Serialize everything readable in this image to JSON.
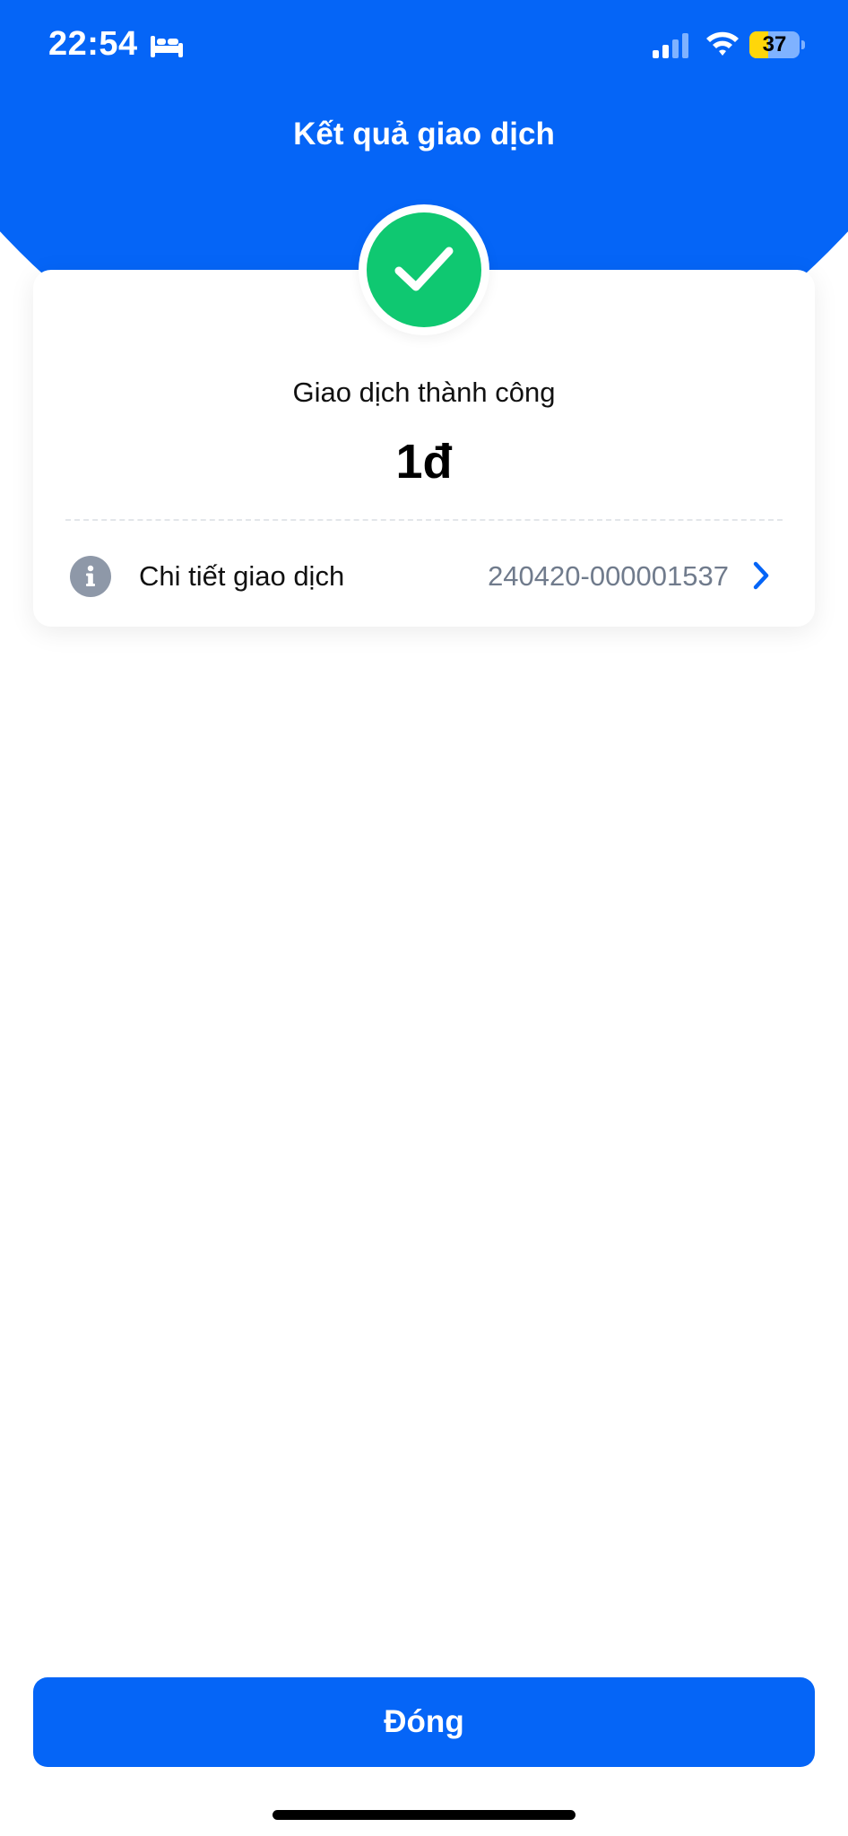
{
  "status_bar": {
    "time": "22:54",
    "focus_icon": "bed-icon",
    "signal_icon": "cellular-signal-icon",
    "wifi_icon": "wifi-icon",
    "battery_level": "37",
    "battery_fraction": 0.37
  },
  "header": {
    "title": "Kết quả giao dịch"
  },
  "result": {
    "icon": "checkmark-icon",
    "status_text": "Giao dịch thành công",
    "amount": "1đ"
  },
  "detail": {
    "icon": "info-icon",
    "label": "Chi tiết giao dịch",
    "transaction_id": "240420-000001537",
    "chevron": "chevron-right-icon"
  },
  "footer": {
    "close_label": "Đóng"
  },
  "colors": {
    "primary_blue": "#0565f7",
    "success_green": "#0fc871",
    "muted_gray": "#707b8c",
    "battery_yellow": "#ffd60a"
  }
}
